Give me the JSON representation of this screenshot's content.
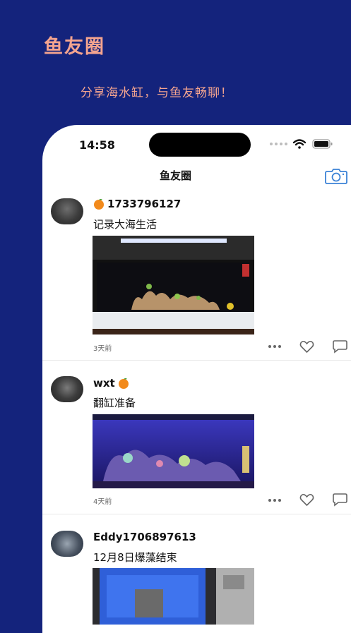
{
  "promo": {
    "title": "鱼友圈",
    "subtitle": "分享海水缸，与鱼友畅聊！"
  },
  "status_bar": {
    "time": "14:58"
  },
  "nav": {
    "title": "鱼友圈",
    "camera_icon": "camera-icon"
  },
  "posts": [
    {
      "username": "1733796127",
      "emoji": "orange",
      "caption": "记录大海生活",
      "time_ago": "3天前"
    },
    {
      "username": "wxt",
      "emoji": "orange",
      "caption": "翻缸准备",
      "time_ago": "4天前"
    },
    {
      "username": "Eddy1706897613",
      "caption": "12月8日爆藻结束"
    }
  ],
  "colors": {
    "background": "#14237c",
    "promo_text": "#f4a48f",
    "accent": "#3b82d6"
  }
}
